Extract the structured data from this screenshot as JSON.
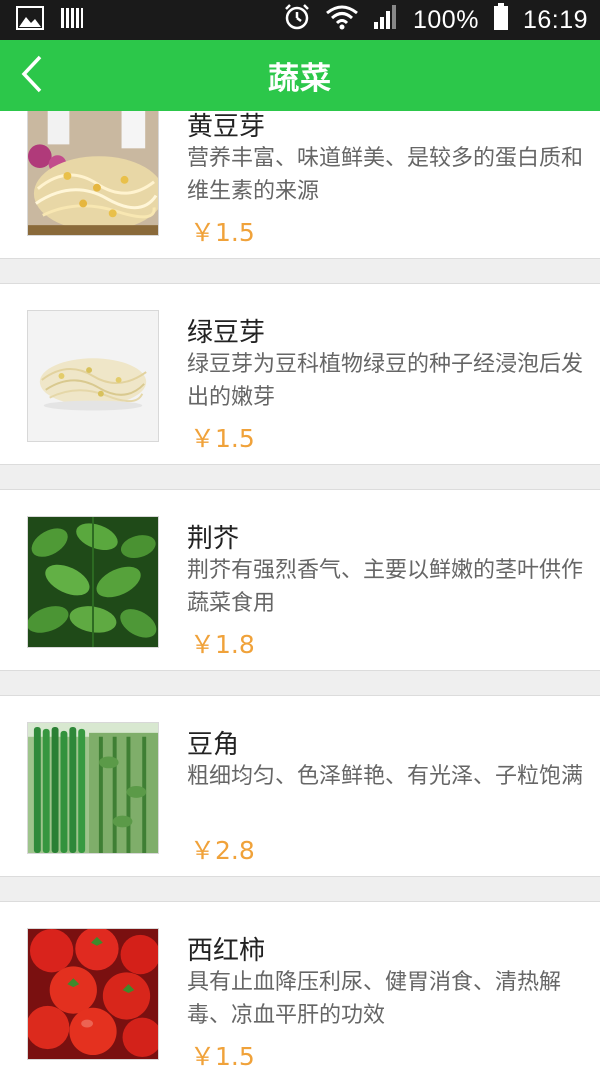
{
  "status": {
    "battery": "100%",
    "time": "16:19",
    "icons": [
      "image-icon",
      "barcode-icon",
      "alarm-icon",
      "wifi-icon",
      "signal-icon",
      "battery-icon"
    ]
  },
  "header": {
    "title": "蔬菜",
    "back_icon": "chevron-left-icon"
  },
  "colors": {
    "header_green": "#2cc74a",
    "price_orange": "#f0a23a",
    "background": "#efefef"
  },
  "products": [
    {
      "name": "黄豆芽",
      "desc": "营养丰富、味道鲜美、是较多的蛋白质和维生素的来源",
      "price": "￥1.5",
      "image": "soybean-sprouts-image"
    },
    {
      "name": "绿豆芽",
      "desc": "绿豆芽为豆科植物绿豆的种子经浸泡后发出的嫩芽",
      "price": "￥1.5",
      "image": "mung-bean-sprouts-image"
    },
    {
      "name": "荆芥",
      "desc": "荆芥有强烈香气、主要以鲜嫩的茎叶供作蔬菜食用",
      "price": "￥1.8",
      "image": "schizonepeta-leaves-image"
    },
    {
      "name": "豆角",
      "desc": "粗细均匀、色泽鲜艳、有光泽、子粒饱满",
      "price": "￥2.8",
      "image": "green-beans-image"
    },
    {
      "name": "西红柿",
      "desc": "具有止血降压利尿、健胃消食、清热解毒、凉血平肝的功效",
      "price": "￥1.5",
      "image": "tomatoes-image"
    }
  ]
}
